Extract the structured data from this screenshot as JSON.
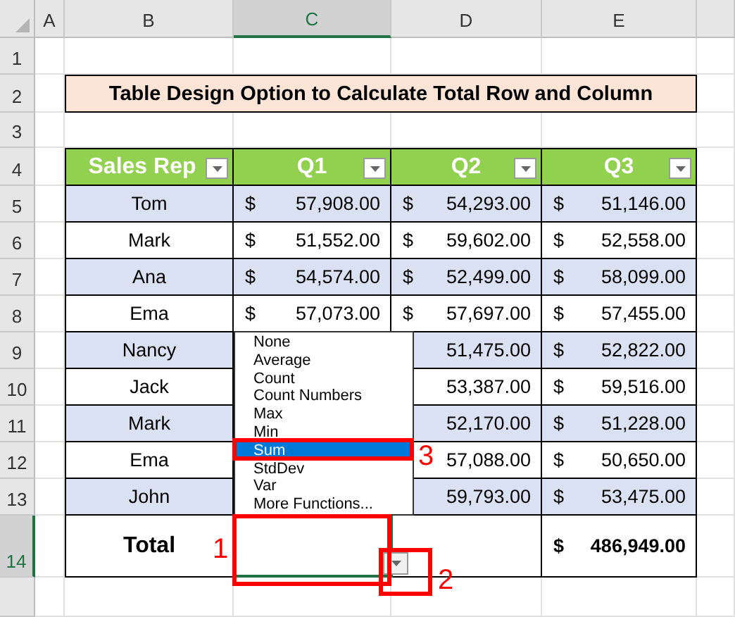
{
  "column_headers": [
    {
      "label": "A",
      "selected": false
    },
    {
      "label": "B",
      "selected": false
    },
    {
      "label": "C",
      "selected": true
    },
    {
      "label": "D",
      "selected": false
    },
    {
      "label": "E",
      "selected": false
    }
  ],
  "row_headers": [
    {
      "label": "1",
      "selected": false
    },
    {
      "label": "2",
      "selected": false
    },
    {
      "label": "3",
      "selected": false
    },
    {
      "label": "4",
      "selected": false
    },
    {
      "label": "5",
      "selected": false
    },
    {
      "label": "6",
      "selected": false
    },
    {
      "label": "7",
      "selected": false
    },
    {
      "label": "8",
      "selected": false
    },
    {
      "label": "9",
      "selected": false
    },
    {
      "label": "10",
      "selected": false
    },
    {
      "label": "11",
      "selected": false
    },
    {
      "label": "12",
      "selected": false
    },
    {
      "label": "13",
      "selected": false
    },
    {
      "label": "14",
      "selected": true
    }
  ],
  "title": "Table Design Option to Calculate Total Row and Column",
  "table": {
    "columns": [
      {
        "label": "Sales Rep"
      },
      {
        "label": "Q1"
      },
      {
        "label": "Q2"
      },
      {
        "label": "Q3"
      }
    ],
    "rows": [
      {
        "name": "Tom",
        "q1": {
          "currency": "$",
          "amount": "57,908.00"
        },
        "q2": {
          "currency": "$",
          "amount": "54,293.00"
        },
        "q3": {
          "currency": "$",
          "amount": "51,146.00"
        }
      },
      {
        "name": "Mark",
        "q1": {
          "currency": "$",
          "amount": "51,552.00"
        },
        "q2": {
          "currency": "$",
          "amount": "59,602.00"
        },
        "q3": {
          "currency": "$",
          "amount": "52,558.00"
        }
      },
      {
        "name": "Ana",
        "q1": {
          "currency": "$",
          "amount": "54,574.00"
        },
        "q2": {
          "currency": "$",
          "amount": "52,499.00"
        },
        "q3": {
          "currency": "$",
          "amount": "58,099.00"
        }
      },
      {
        "name": "Ema",
        "q1": {
          "currency": "$",
          "amount": "57,073.00"
        },
        "q2": {
          "currency": "$",
          "amount": "57,697.00"
        },
        "q3": {
          "currency": "$",
          "amount": "57,455.00"
        }
      },
      {
        "name": "Nancy",
        "q2": {
          "amount": "51,475.00"
        },
        "q3": {
          "currency": "$",
          "amount": "52,822.00"
        }
      },
      {
        "name": "Jack",
        "q2": {
          "amount": "53,387.00"
        },
        "q3": {
          "currency": "$",
          "amount": "59,516.00"
        }
      },
      {
        "name": "Mark",
        "q2": {
          "amount": "52,170.00"
        },
        "q3": {
          "currency": "$",
          "amount": "51,228.00"
        }
      },
      {
        "name": "Ema",
        "q2": {
          "amount": "57,088.00"
        },
        "q3": {
          "currency": "$",
          "amount": "50,650.00"
        }
      },
      {
        "name": "John",
        "q2": {
          "amount": "59,793.00"
        },
        "q3": {
          "currency": "$",
          "amount": "53,475.00"
        }
      }
    ],
    "total": {
      "label": "Total",
      "q3": {
        "currency": "$",
        "amount": "486,949.00"
      }
    }
  },
  "total_dropdown": {
    "items": [
      {
        "label": "None",
        "selected": false
      },
      {
        "label": "Average",
        "selected": false
      },
      {
        "label": "Count",
        "selected": false
      },
      {
        "label": "Count Numbers",
        "selected": false
      },
      {
        "label": "Max",
        "selected": false
      },
      {
        "label": "Min",
        "selected": false
      },
      {
        "label": "Sum",
        "selected": true
      },
      {
        "label": "StdDev",
        "selected": false
      },
      {
        "label": "Var",
        "selected": false
      },
      {
        "label": "More Functions...",
        "selected": false
      }
    ]
  },
  "annotations": [
    {
      "label": "1"
    },
    {
      "label": "2"
    },
    {
      "label": "3"
    }
  ]
}
